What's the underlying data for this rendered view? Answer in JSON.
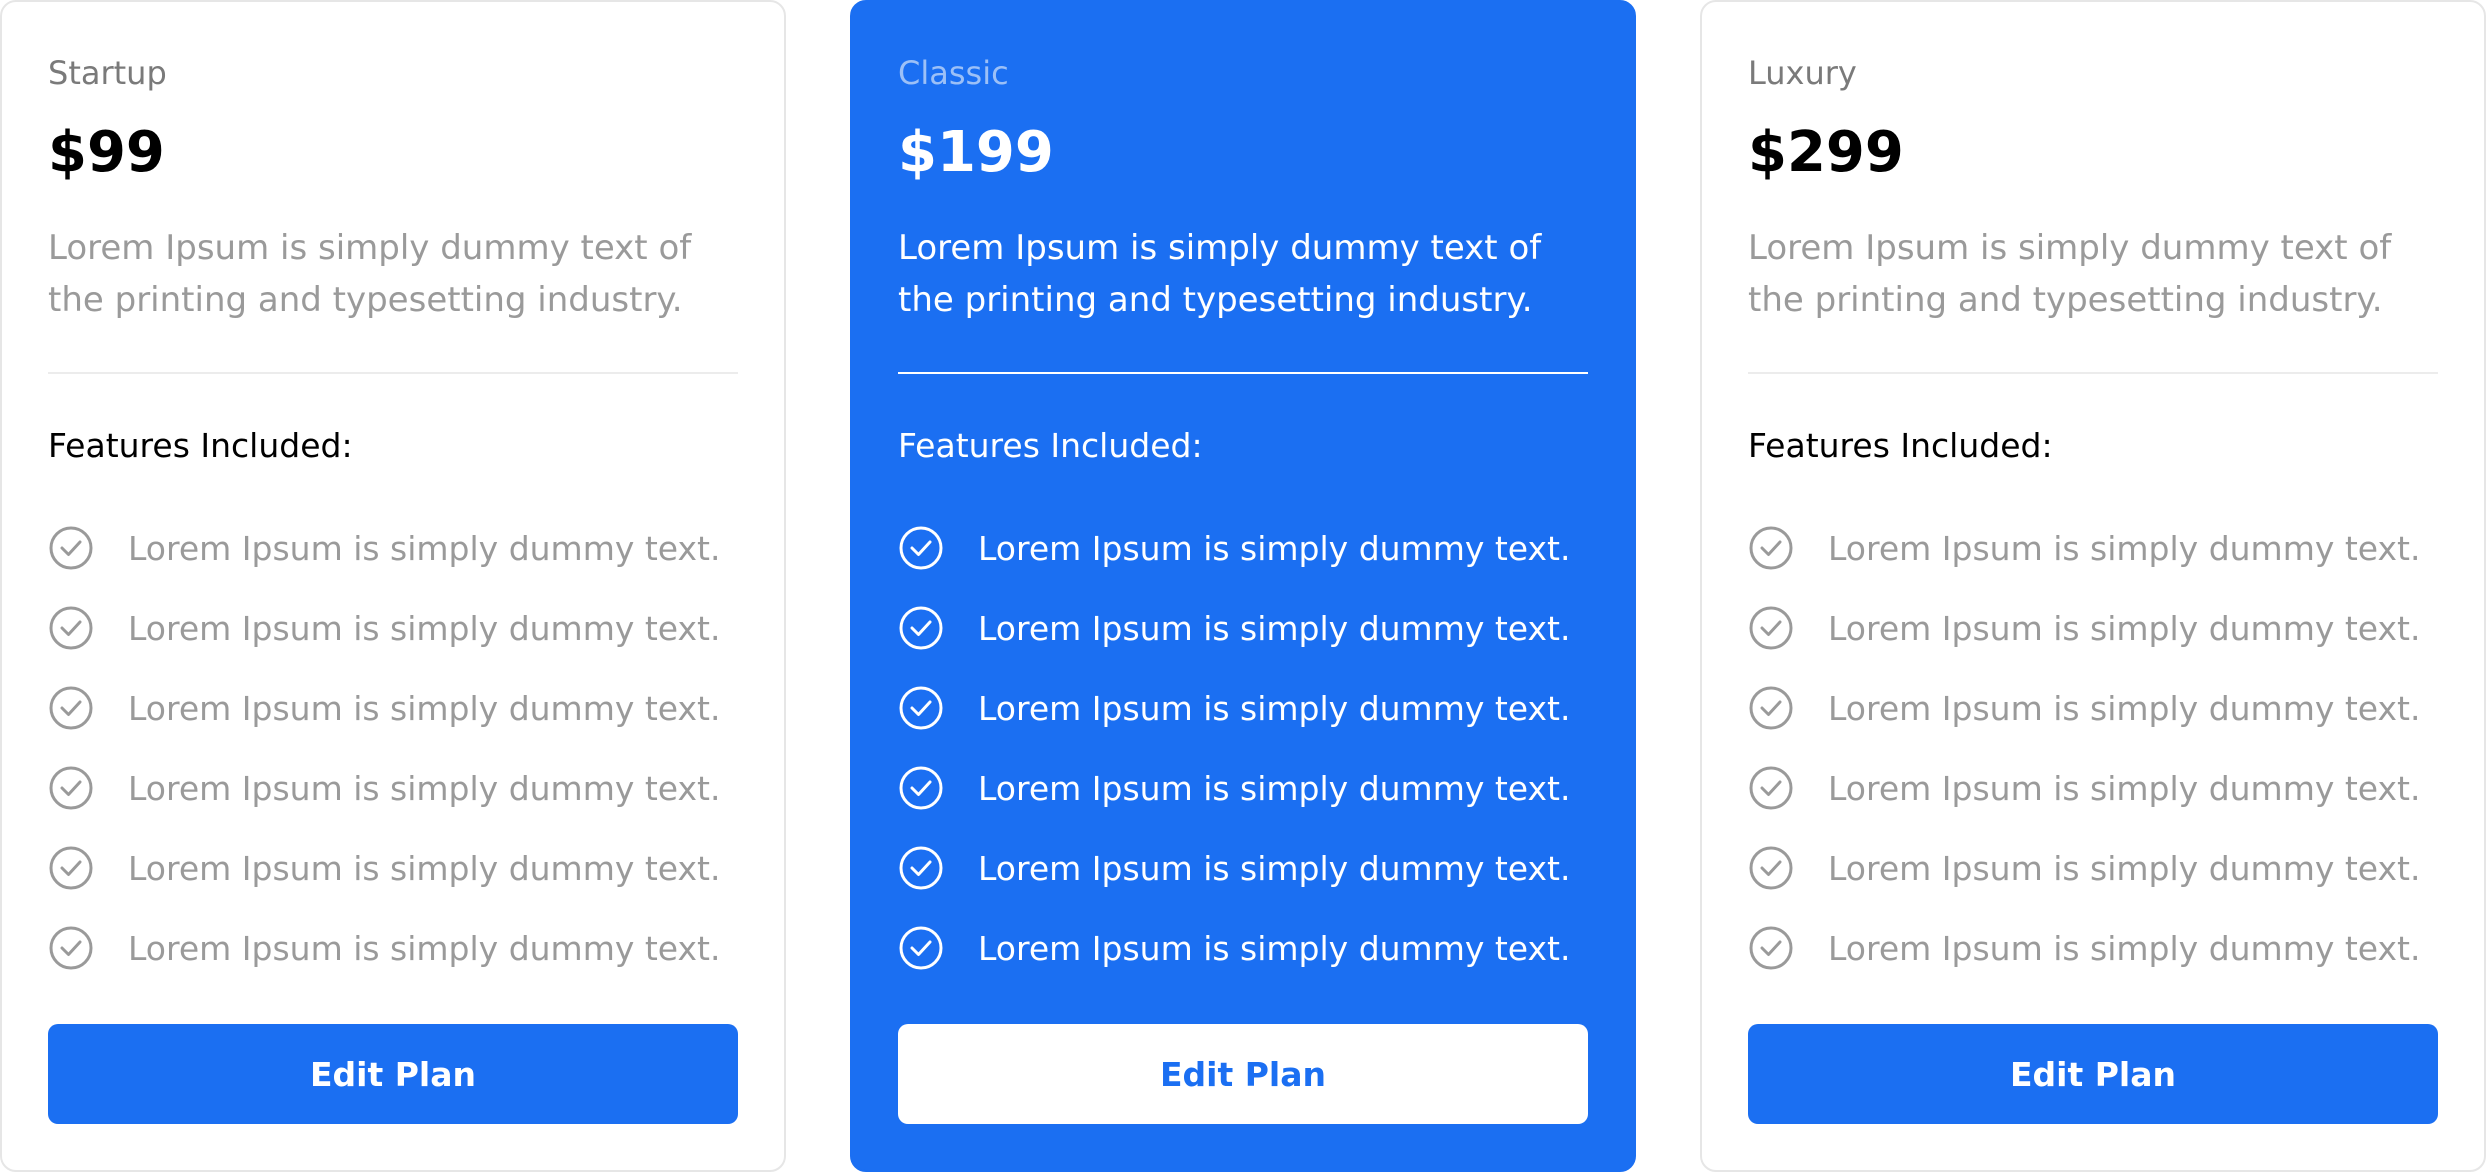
{
  "colors": {
    "accent": "#1b6ff2",
    "muted_text": "#9a9a9a",
    "card_border": "#e6e6e6"
  },
  "plans": [
    {
      "name": "Startup",
      "price": "$99",
      "description": "Lorem Ipsum is simply dummy text of the printing and typesetting industry.",
      "features_heading": "Features Included:",
      "features": [
        "Lorem Ipsum is simply dummy text.",
        "Lorem Ipsum is simply dummy text.",
        "Lorem Ipsum is simply dummy text.",
        "Lorem Ipsum is simply dummy text.",
        "Lorem Ipsum is simply dummy text.",
        "Lorem Ipsum is simply dummy text."
      ],
      "feature_icon": "check-circle-icon",
      "button_label": "Edit Plan"
    },
    {
      "name": "Classic",
      "price": "$199",
      "description": "Lorem Ipsum is simply dummy text of the printing and typesetting industry.",
      "features_heading": "Features Included:",
      "features": [
        "Lorem Ipsum is simply dummy text.",
        "Lorem Ipsum is simply dummy text.",
        "Lorem Ipsum is simply dummy text.",
        "Lorem Ipsum is simply dummy text.",
        "Lorem Ipsum is simply dummy text.",
        "Lorem Ipsum is simply dummy text."
      ],
      "feature_icon": "check-circle-icon",
      "button_label": "Edit Plan"
    },
    {
      "name": "Luxury",
      "price": "$299",
      "description": "Lorem Ipsum is simply dummy text of the printing and typesetting industry.",
      "features_heading": "Features Included:",
      "features": [
        "Lorem Ipsum is simply dummy text.",
        "Lorem Ipsum is simply dummy text.",
        "Lorem Ipsum is simply dummy text.",
        "Lorem Ipsum is simply dummy text.",
        "Lorem Ipsum is simply dummy text.",
        "Lorem Ipsum is simply dummy text."
      ],
      "feature_icon": "check-circle-icon",
      "button_label": "Edit Plan"
    }
  ]
}
